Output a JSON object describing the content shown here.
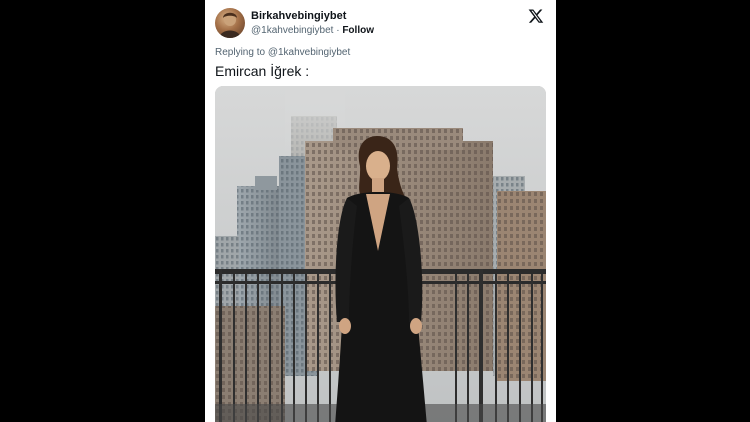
{
  "tweet": {
    "display_name": "Birkahvebingiybet",
    "handle": "@1kahvebingiybet",
    "separator": " · ",
    "follow_label": "Follow",
    "replying_prefix": "Replying to ",
    "replying_handle": "@1kahvebingiybet",
    "text": "Emircan İğrek :"
  },
  "icons": {
    "platform": "x-logo-icon",
    "avatar": "avatar"
  },
  "colors": {
    "page_background": "#000000",
    "card_background": "#ffffff",
    "primary_text": "#0f1419",
    "secondary_text": "#536471"
  }
}
